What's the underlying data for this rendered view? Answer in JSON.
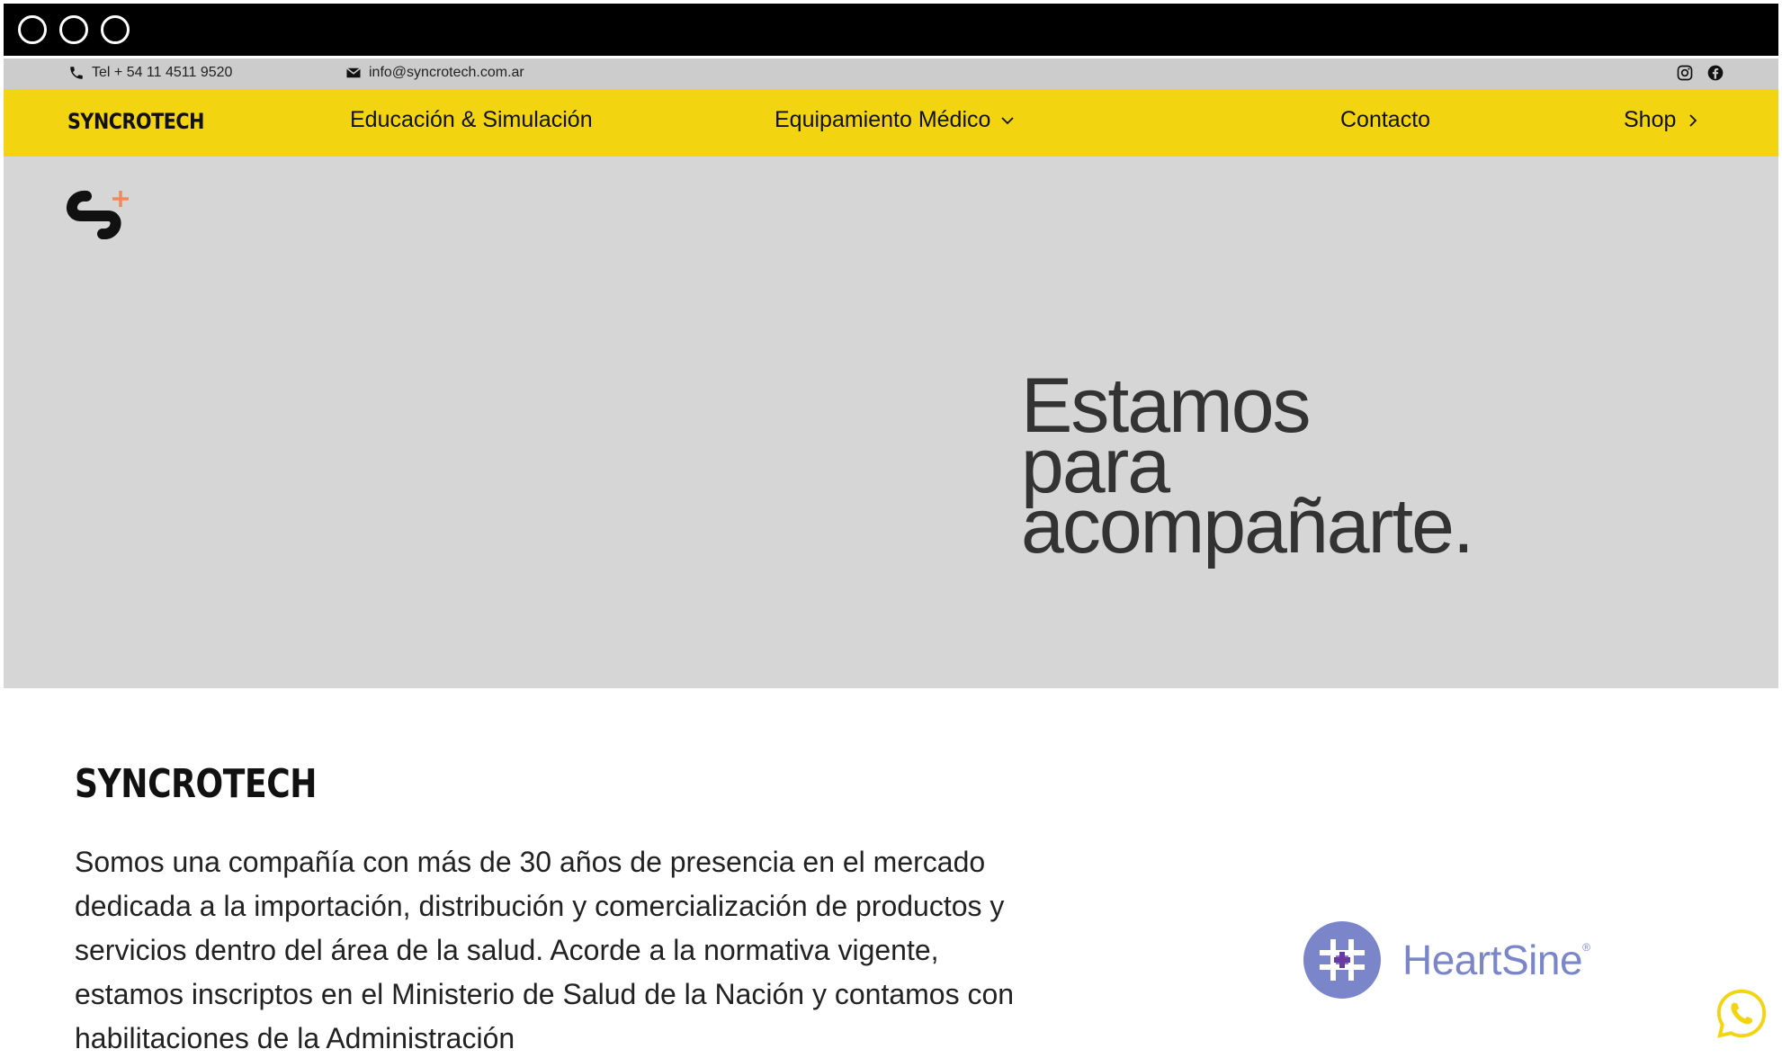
{
  "contact": {
    "phone": "Tel + 54 11 4511 9520",
    "email": "info@syncrotech.com.ar"
  },
  "nav": {
    "brand": "SYNCROTECH",
    "items": [
      {
        "label": "Educación & Simulación"
      },
      {
        "label": "Equipamiento Médico"
      },
      {
        "label": "Contacto"
      },
      {
        "label": "Shop"
      }
    ]
  },
  "hero": {
    "lines": [
      "Estamos",
      "para",
      "acompañarte."
    ]
  },
  "about": {
    "title": "SYNCROTECH",
    "text": "Somos una compañía con más de 30 años de presencia en el mercado dedicada a la importación, distribución y comercialización de productos y servicios dentro del área de la salud. Acorde a la normativa vigente, estamos inscriptos en el Ministerio de Salud de la Nación y contamos con habilitaciones de la Administración"
  },
  "partner": {
    "name": "HeartSine"
  },
  "colors": {
    "nav_bg": "#f2d411",
    "hero_bg": "#d6d6d6",
    "accent_plus": "#f08a5d",
    "heartsine": "#7a86c9",
    "whatsapp": "#f2d411"
  }
}
